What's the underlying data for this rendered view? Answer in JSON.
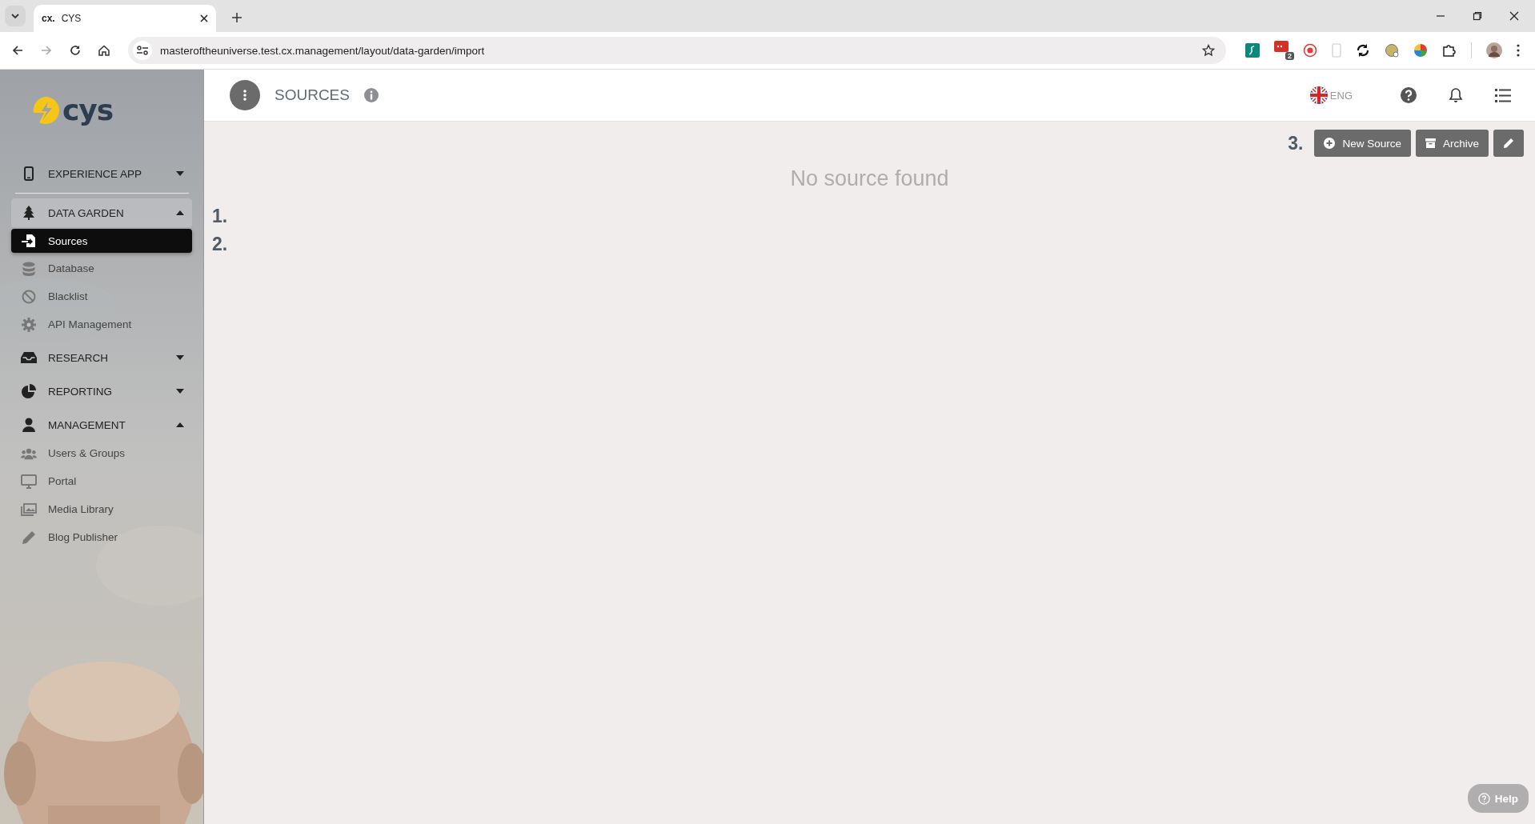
{
  "browser": {
    "tab": {
      "brand": "cx.",
      "title": "CYS"
    },
    "url": "masteroftheuniverse.test.cx.management/layout/data-garden/import",
    "extension_badge": "2"
  },
  "sidebar": {
    "logo": "cys",
    "sections": [
      {
        "label": "EXPERIENCE APP",
        "expanded": false,
        "selected": false
      },
      {
        "label": "DATA GARDEN",
        "expanded": true,
        "selected": true,
        "children": [
          {
            "label": "Sources",
            "selected": true
          },
          {
            "label": "Database",
            "selected": false
          },
          {
            "label": "Blacklist",
            "selected": false
          },
          {
            "label": "API Management",
            "selected": false
          }
        ]
      },
      {
        "label": "RESEARCH",
        "expanded": false,
        "selected": false
      },
      {
        "label": "REPORTING",
        "expanded": false,
        "selected": false
      },
      {
        "label": "MANAGEMENT",
        "expanded": true,
        "selected": false,
        "children": [
          {
            "label": "Users & Groups",
            "selected": false
          },
          {
            "label": "Portal",
            "selected": false
          },
          {
            "label": "Media Library",
            "selected": false
          },
          {
            "label": "Blog Publisher",
            "selected": false
          }
        ]
      }
    ]
  },
  "header": {
    "title": "SOURCES",
    "language": "ENG"
  },
  "annotations": [
    "1.",
    "2.",
    "3."
  ],
  "buttons": [
    "New Source",
    "Archive"
  ],
  "empty_message": "No source found",
  "help_button": "Help"
}
